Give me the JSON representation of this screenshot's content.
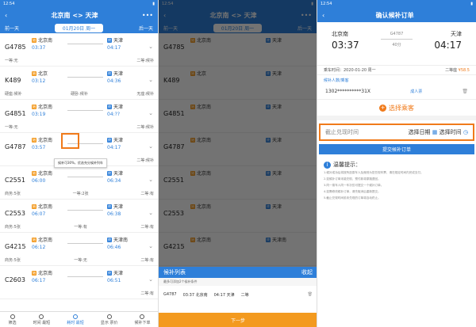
{
  "s1": {
    "status_time": "12:54",
    "title": "北京南 <> 天津",
    "prev_day": "前一天",
    "date": "01月20日 周一",
    "next_day": "后一天",
    "trains": [
      {
        "num": "G4785",
        "from": "北京南",
        "to": "天津",
        "dep": "03:37",
        "arr": "04:17",
        "seats": [
          "一等:无",
          "二等:候补"
        ]
      },
      {
        "num": "K489",
        "from": "北京",
        "to": "天津",
        "dep": "03:12",
        "arr": "04:36",
        "seats": [
          "硬座:候补",
          "硬卧:候补",
          "无座:候补"
        ]
      },
      {
        "num": "G4851",
        "from": "北京南",
        "to": "天津",
        "dep": "03:19",
        "arr": "04:??",
        "seats": [
          "一等:无",
          "二等:候补"
        ]
      },
      {
        "num": "G4787",
        "from": "北京南",
        "to": "天津",
        "dep": "03:57",
        "arr": "04:17",
        "seats": [
          "",
          "二等:候补"
        ]
      },
      {
        "num": "C2551",
        "from": "北京南",
        "to": "天津",
        "dep": "06:00",
        "arr": "06:34",
        "seats": [
          "商务:5张",
          "一等:2张",
          "二等:有"
        ]
      },
      {
        "num": "C2553",
        "from": "北京南",
        "to": "天津",
        "dep": "06:07",
        "arr": "06:38",
        "seats": [
          "商务:5张",
          "一等:有",
          "二等:有"
        ]
      },
      {
        "num": "G4215",
        "from": "北京南",
        "to": "天津南",
        "dep": "06:12",
        "arr": "06:46",
        "seats": [
          "商务:5张",
          "一等:无",
          "二等:有"
        ]
      },
      {
        "num": "C2603",
        "from": "北京南",
        "to": "天津",
        "dep": "06:17",
        "arr": "06:51",
        "seats": [
          "",
          "二等:有"
        ]
      }
    ],
    "tooltip": "候补可30%，优选充分候补列车",
    "nav": [
      "筛选",
      "时间 最短",
      "耗时 最短",
      "显示 票价",
      "候补下单"
    ]
  },
  "s2": {
    "sheet_title": "候补列表",
    "sheet_close": "收起",
    "sheet_sub": "最多可添加2个候补条件",
    "row": {
      "num": "G4787",
      "dep": "03:37 北京南",
      "arr": "04:17 天津",
      "seat": "二等",
      "tag": "候补"
    },
    "next": "下一步"
  },
  "s3": {
    "title": "确认候补订单",
    "from_city": "北京南",
    "dep": "03:37",
    "train": "G4787",
    "duration": "40分",
    "to_city": "天津",
    "arr": "04:17",
    "date_label": "乘车时间：2020-01-20 周一",
    "seat_label": "二等座",
    "price": "¥58.5",
    "link": "候补人数/乘客",
    "pax_id": "1302**********31X",
    "pax_type": "成人票",
    "select_pax": "选择乘客",
    "deadline_label": "截止兑现时间",
    "pick_date": "选择日期",
    "pick_time": "选择时间",
    "submit": "提交候补订单",
    "tips_title": "温馨提示：",
    "tips": [
      "1.候补成功后将按所选乘车人及席别为您兑现车票，请在规定时间内完成支付。",
      "2.如候补订单未能兑现，预付款将原路退回。",
      "3.同一乘车人同一车次仅可提交一个候补订单。",
      "4.如需修改候补订单，请先取消后重新提交。",
      "5.截止兑现时间前未兑现的订单将自动终止。"
    ]
  },
  "colors": {
    "primary": "#2e7fd9",
    "accent": "#f07a1a"
  }
}
